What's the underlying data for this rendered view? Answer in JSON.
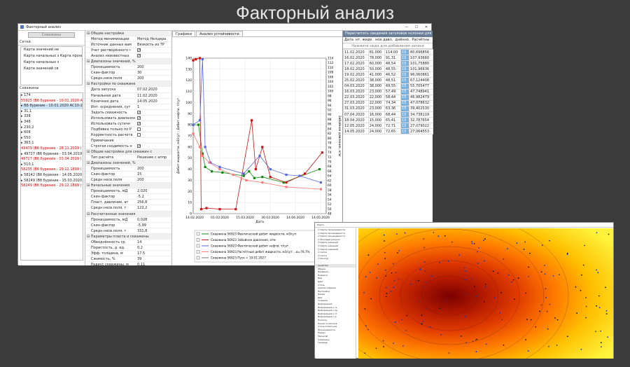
{
  "page_title": "Факторный анализ",
  "window": {
    "title": "Факторный анализ",
    "min": "—",
    "max": "☐",
    "close": "✕"
  },
  "left": {
    "wells_button": "Скважины",
    "grids_label": "Сетки",
    "maps": [
      "Карта значений не",
      "Карта начальных з Карта проницаемо",
      "Карта начальных з",
      "Карта значений св"
    ],
    "wells_label": "Скважины",
    "wells": [
      {
        "text": "174",
        "red": false,
        "sel": false
      },
      {
        "text": "55925 (Вб бурение - 10.01.2020 АС1",
        "red": true,
        "sel": false
      },
      {
        "text": "ВБ бурение - 10.01.2020 АС10-2",
        "red": false,
        "sel": true
      },
      {
        "text": "31,1",
        "red": false,
        "sel": false
      },
      {
        "text": "338",
        "red": false,
        "sel": false
      },
      {
        "text": "348",
        "red": false,
        "sel": false
      },
      {
        "text": "230,2",
        "red": false,
        "sel": false
      },
      {
        "text": "608",
        "red": false,
        "sel": false
      },
      {
        "text": "550",
        "red": false,
        "sel": false
      },
      {
        "text": "363,1",
        "red": false,
        "sel": false
      },
      {
        "text": "43479 (Вб бурение - 28.11.2019 )",
        "red": true,
        "sel": false
      },
      {
        "text": "49727 (Вб бурение - 03.04.2019 )",
        "red": false,
        "sel": false
      },
      {
        "text": "49727 (Вб бурение - 03.04.2019 )",
        "red": true,
        "sel": false
      },
      {
        "text": "510,1",
        "red": false,
        "sel": false
      },
      {
        "text": "58235 (Вб бурение - 29.12.1899 )",
        "red": true,
        "sel": false
      },
      {
        "text": "58242 (Вб бурение - 14.05.2020 АС1",
        "red": false,
        "sel": false
      },
      {
        "text": "58249 (Вб бурение - 15.03.2020 АС1",
        "red": false,
        "sel": false
      },
      {
        "text": "58249 (Вб бурение - 29.12.1899 )",
        "red": true,
        "sel": false
      }
    ]
  },
  "props": [
    {
      "h": "Общие настройки"
    },
    {
      "l": "Метод минимизации",
      "v": "Метод Нелдера"
    },
    {
      "l": "Источник данных вам",
      "v": "Вязкость из ТР"
    },
    {
      "l": "Учет растворённого г",
      "c": true
    },
    {
      "l": "Анализ неизвестных",
      "c": true
    },
    {
      "h": "Диапазоны значений, %"
    },
    {
      "l": "Проницаемость",
      "v": "200"
    },
    {
      "l": "Скин-фактор",
      "v": "30"
    },
    {
      "l": "Средн.несв.поля",
      "v": "200"
    },
    {
      "h": "Настройки по скважине"
    },
    {
      "l": "Дата запуска",
      "v": "07.02.2020"
    },
    {
      "l": "Начальная дата",
      "v": "11.02.2020"
    },
    {
      "l": "Конечная дата",
      "v": "14.05.2020"
    },
    {
      "l": "Инт. осреднения, сут",
      "v": "1"
    },
    {
      "l": "Задать скважность",
      "c": true
    },
    {
      "l": "Использовать диапазон",
      "c": true
    },
    {
      "l": "Использовать сутечн",
      "c": true
    },
    {
      "l": "Подбивка только по Р",
      "c": false
    },
    {
      "l": "Корректность расчета",
      "c": false
    },
    {
      "l": "Примечание",
      "v": ""
    },
    {
      "l": "Строгая сходимость н",
      "c": true
    },
    {
      "h": "Общие настройки для скважин с"
    },
    {
      "l": "Тип расчёта",
      "v": "Решение с аппр"
    },
    {
      "h": "Диапазоны значений, %"
    },
    {
      "l": "Проницаемость",
      "v": "200"
    },
    {
      "l": "Скин-фактор",
      "v": "15"
    },
    {
      "l": "Средн.несв.поля",
      "v": "200"
    },
    {
      "h": "Начальные значения"
    },
    {
      "l": "Проницаемость, мД",
      "v": "2,020"
    },
    {
      "l": "Скин-фактор",
      "v": "-5,2"
    },
    {
      "l": "Пласт. давление, ат",
      "v": "256,8"
    },
    {
      "l": "Средн.несв.поля, т",
      "v": "122,2"
    },
    {
      "h": "Рассчитанные значения"
    },
    {
      "l": "Проницаемость, мД",
      "v": "0,028"
    },
    {
      "l": "Скин-фактор",
      "v": "-5,99"
    },
    {
      "l": "Средн.несв.поля, т",
      "v": "331,8"
    },
    {
      "h": "Параметры пласта и скважины"
    },
    {
      "l": "Обводнённость ср.",
      "v": "14"
    },
    {
      "l": "Пористость, д. ед.",
      "v": "0,2"
    },
    {
      "l": "Эфф. толщина, м",
      "v": "17,5"
    },
    {
      "l": "Сжимость, %",
      "v": "39"
    },
    {
      "l": "Радиус скважины, м",
      "v": "0,11"
    }
  ],
  "center": {
    "tabs": [
      "Графики",
      "Анализ устойчивости"
    ]
  },
  "chart_data": {
    "type": "line",
    "x": [
      "14.02.2020",
      "01.03.2020",
      "15.03.2020",
      "30.03.2020",
      "14.04.2020",
      "14.05.2020"
    ],
    "xlabel": "Дата",
    "ylabel_left": "Дебит жидкости, м3/сут ; Дебит нефти, т/сут",
    "ylabel_right": "Забойное давление, атм",
    "ylim_left": [
      0,
      140
    ],
    "ylim_right": [
      48,
      114
    ],
    "left_ticks": [
      "0",
      "10",
      "20",
      "30",
      "40",
      "50",
      "60",
      "70",
      "80",
      "90",
      "100",
      "110",
      "120",
      "130",
      "140"
    ],
    "right_ticks": [
      "48",
      "50",
      "52",
      "54",
      "56",
      "58",
      "60",
      "62",
      "64",
      "66",
      "68",
      "70",
      "72",
      "74",
      "76",
      "78",
      "80",
      "82",
      "84",
      "86",
      "88",
      "90",
      "92",
      "94",
      "96",
      "98",
      "100",
      "102",
      "104",
      "106",
      "108",
      "110",
      "112",
      "114"
    ],
    "series": [
      {
        "name": "Скважина 56923 Фактический дебит жидкости, м3/сут",
        "color": "#118811",
        "pts": [
          [
            0,
            80
          ],
          [
            0.04,
            80
          ],
          [
            0.07,
            54
          ],
          [
            0.09,
            42
          ],
          [
            0.14,
            38
          ],
          [
            0.22,
            37
          ],
          [
            0.38,
            34
          ],
          [
            0.42,
            38
          ],
          [
            0.46,
            32
          ],
          [
            0.52,
            33
          ],
          [
            0.68,
            28
          ],
          [
            0.95,
            40
          ]
        ]
      },
      {
        "name": "Скважина 56923 Забойное давление, атм",
        "color": "#cc1111",
        "pts": [
          [
            0,
            138
          ],
          [
            0.02,
            139
          ],
          [
            0.05,
            140
          ],
          [
            0.06,
            4
          ],
          [
            0.1,
            5
          ],
          [
            0.2,
            4
          ],
          [
            0.32,
            4
          ],
          [
            0.44,
            84
          ],
          [
            0.47,
            40
          ],
          [
            0.52,
            60
          ],
          [
            0.58,
            33
          ],
          [
            0.7,
            28
          ],
          [
            0.84,
            36
          ],
          [
            0.97,
            55
          ]
        ]
      },
      {
        "name": "Скважина 56923 Фактический дебит нефти, т/сут",
        "color": "#5566dd",
        "pts": [
          [
            0,
            80
          ],
          [
            0.05,
            84
          ],
          [
            0.07,
            139
          ],
          [
            0.09,
            60
          ],
          [
            0.13,
            46
          ],
          [
            0.2,
            42
          ],
          [
            0.38,
            36
          ],
          [
            0.5,
            52
          ],
          [
            0.58,
            40
          ],
          [
            0.7,
            35
          ],
          [
            0.8,
            34
          ],
          [
            0.96,
            28
          ]
        ]
      },
      {
        "name": "Скважина 56923 Расчётный дебит жидкости, м3/сут ...в=76,7%",
        "color": "#ff7777",
        "pts": [
          [
            0,
            72
          ],
          [
            0.05,
            60
          ],
          [
            0.07,
            52
          ],
          [
            0.12,
            46
          ],
          [
            0.2,
            40
          ],
          [
            0.3,
            35
          ],
          [
            0.4,
            30
          ],
          [
            0.52,
            28
          ],
          [
            0.7,
            24
          ],
          [
            0.96,
            22
          ]
        ]
      },
      {
        "name": "Скважина 56923 Пуск = 19.01.2027",
        "color": "#777777",
        "pts": []
      }
    ]
  },
  "right_panel": {
    "header": "Пересчитать сведения заголовок колонки для группировки",
    "cols": [
      "Дата",
      "нт. жидк.",
      "ное давл.",
      "днённо.",
      "Расчётны"
    ],
    "add_row": "Нажмите сюда для добавления записи",
    "rows": [
      [
        "11.02.2020",
        "81,000",
        "114,00",
        "15",
        "80,696856"
      ],
      [
        "16.02.2020",
        "78,000",
        "91,31",
        "15",
        "107,93660"
      ],
      [
        "17.02.2020",
        "60,000",
        "48,54",
        "15",
        "101,75880"
      ],
      [
        "18.02.2020",
        "50,000",
        "48,55",
        "15",
        "101,96636"
      ],
      [
        "19.02.2020",
        "41,000",
        "46,52",
        "15",
        "96,060861"
      ],
      [
        "25.02.2020",
        "38,000",
        "48,51",
        "15",
        "67,124408"
      ],
      [
        "04.03.2020",
        "38,000",
        "49,55",
        "15",
        "55,705477"
      ],
      [
        "16.03.2020",
        "23,000",
        "57,49",
        "15",
        "47,748941"
      ],
      [
        "22.03.2020",
        "22,000",
        "58,44",
        "15",
        "46,982479"
      ],
      [
        "27.03.2020",
        "22,000",
        "74,34",
        "15",
        "47,078632"
      ],
      [
        "31.03.2020",
        "23,000",
        "63,36",
        "15",
        "39,402530"
      ],
      [
        "07.04.2020",
        "16,000",
        "68,44",
        "15",
        "34,738119"
      ],
      [
        "18.04.2020",
        "15,000",
        "65,41",
        "15",
        "32,787654"
      ],
      [
        "12.05.2020",
        "24,000",
        "72,71",
        "15",
        "27,079022"
      ],
      [
        "14.05.2020",
        "24,000",
        "72,65",
        "15",
        "27,064553"
      ]
    ]
  },
  "win2": {
    "title": "Карта",
    "tree": [
      "Карты проницаемости",
      "Карта проницаемости",
      "Карта проницаемости",
      "Фоновый рисунок",
      "Карта значений",
      "Карта значений",
      "Карта значений",
      "Сетка",
      "Сетка",
      "Контур"
    ],
    "props_title": "Свойства",
    "props": [
      "Общие",
      "Название",
      "Подписи",
      "Вид",
      "Цвет",
      "Стиль",
      "Анализ скважин",
      "Настройки",
      "Линии",
      "Шаг",
      "Толщина",
      "Информация",
      "Информация о ск",
      "Информация о пр",
      "Информация о ст",
      "Информация о ж",
      "Полигон",
      "Линии полигонов",
      "Стиль полигонов",
      "Проницаемость",
      "Радиус",
      "Масштаб",
      "Скважины",
      "Границы"
    ]
  }
}
